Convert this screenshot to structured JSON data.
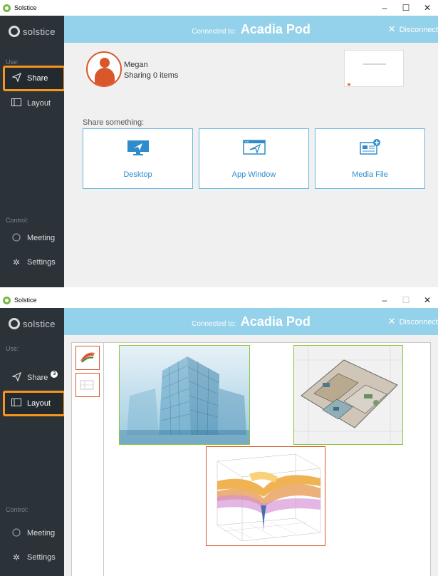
{
  "app": {
    "title": "Solstice",
    "logo_text": "solstice",
    "window_controls": {
      "minimize": "–",
      "maximize": "☐",
      "close": "✕"
    }
  },
  "sidebar": {
    "use_label": "Use:",
    "control_label": "Control:",
    "items": {
      "share": {
        "label": "Share",
        "icon": "send-icon"
      },
      "layout": {
        "label": "Layout",
        "icon": "layout-icon"
      },
      "meeting": {
        "label": "Meeting",
        "icon": "meeting-icon"
      },
      "settings": {
        "label": "Settings",
        "icon": "gear-icon"
      }
    },
    "share_badge": "3"
  },
  "topbar": {
    "connected_prefix": "Connected to:",
    "pod_name": "Acadia Pod",
    "disconnect_label": "Disconnect",
    "disconnect_icon": "close-icon"
  },
  "share_view": {
    "user_name": "Megan",
    "sharing_status": "Sharing 0 items",
    "share_something_label": "Share something:",
    "cards": [
      {
        "label": "Desktop",
        "icon": "desktop-icon"
      },
      {
        "label": "App Window",
        "icon": "app-window-icon"
      },
      {
        "label": "Media File",
        "icon": "media-file-icon"
      }
    ]
  },
  "layout_view": {
    "thumbnails": [
      "chart-thumbnail",
      "blueprint-thumbnail"
    ],
    "tiles": [
      "building-wireframe-image",
      "floorplan-3d-image",
      "surface-plot-image"
    ]
  },
  "colors": {
    "sidebar_bg": "#2b3238",
    "accent_blue": "#94d1ea",
    "highlight_orange": "#f7941d",
    "user_orange": "#d9572b",
    "user_green": "#8cc63f",
    "link_blue": "#2f8ccc"
  }
}
